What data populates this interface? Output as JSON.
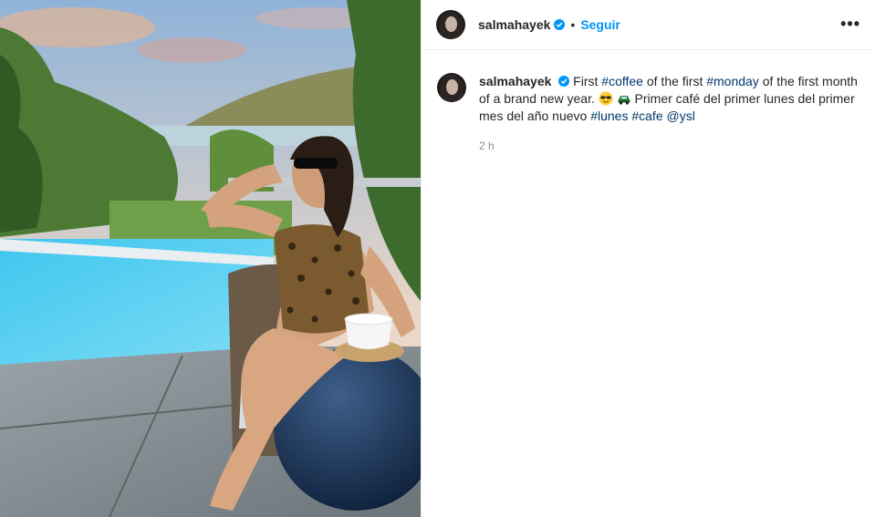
{
  "post": {
    "username": "salmahayek",
    "follow_label": "Seguir",
    "dot": "•",
    "more_label": "•••",
    "caption": {
      "username": "salmahayek",
      "t1": " First ",
      "tag_coffee": "#coffee",
      "t2": " of the first ",
      "tag_monday": "#monday",
      "t3": " of the first month of a brand new year. ",
      "t4": " Primer café del primer lunes del primer mes del año nuevo ",
      "tag_lunes": "#lunes",
      "tag_cafe": "#cafe",
      "mention": "@ysl",
      "emojis": [
        "sunglasses-face",
        "car"
      ]
    },
    "time": "2 h",
    "colors": {
      "accent": "#0095f6",
      "link": "#00376b",
      "verified": "#0095f6"
    }
  }
}
